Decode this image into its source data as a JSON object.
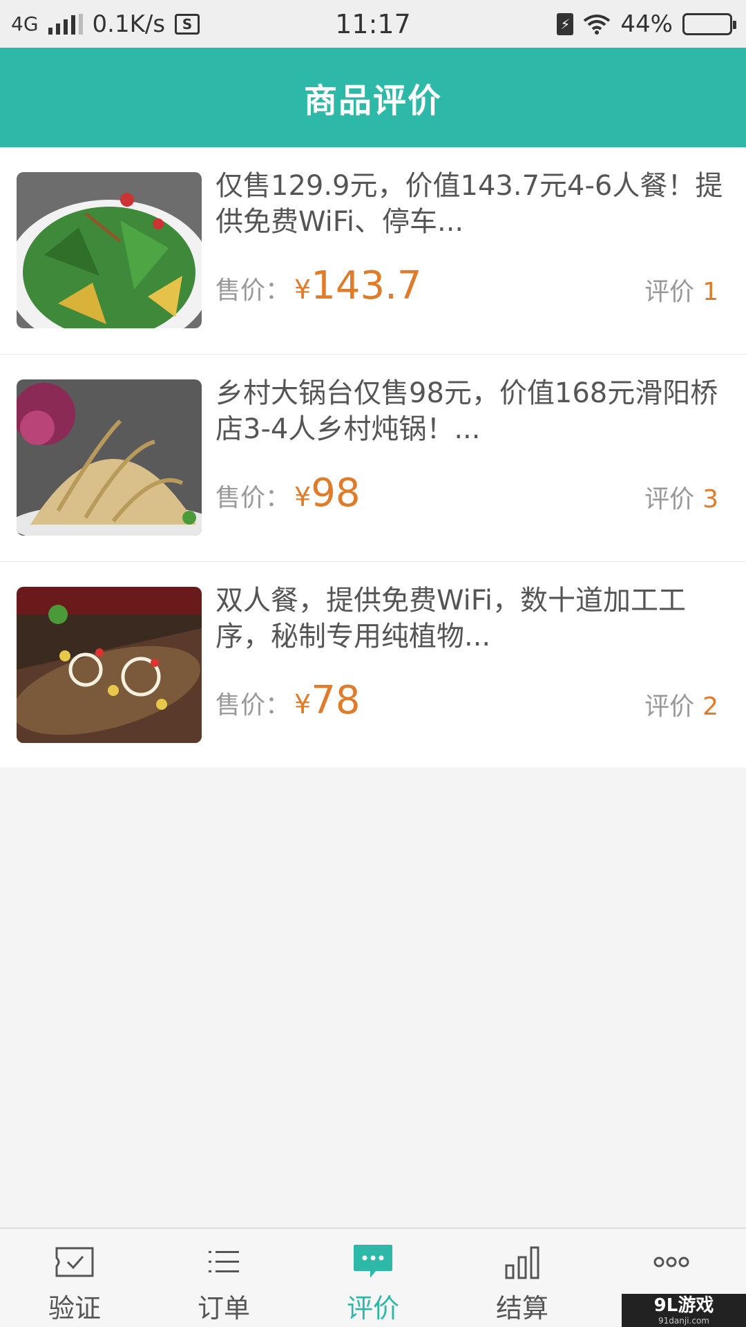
{
  "status_bar": {
    "network": "4G",
    "speed": "0.1K/s",
    "time": "11:17",
    "battery_percent": "44%",
    "battery_level": 0.44
  },
  "header": {
    "title": "商品评价"
  },
  "products": [
    {
      "title": "仅售129.9元，价值143.7元4-6人餐！提供免费WiFi、停车...",
      "price_label": "售价：",
      "currency": "¥",
      "price": "143.7",
      "review_label": "评价",
      "review_count": "1",
      "image": "salad-dish"
    },
    {
      "title": "乡村大锅台仅售98元，价值168元滑阳桥店3-4人乡村炖锅！...",
      "price_label": "售价：",
      "currency": "¥",
      "price": "98",
      "review_label": "评价",
      "review_count": "3",
      "image": "tofu-noodle-dish"
    },
    {
      "title": "双人餐，提供免费WiFi，数十道加工工序，秘制专用纯植物...",
      "price_label": "售价：",
      "currency": "¥",
      "price": "78",
      "review_label": "评价",
      "review_count": "2",
      "image": "grilled-fish-dish"
    }
  ],
  "bottom_nav": [
    {
      "label": "验证",
      "icon": "envelope-check-icon",
      "active": false
    },
    {
      "label": "订单",
      "icon": "list-icon",
      "active": false
    },
    {
      "label": "评价",
      "icon": "chat-bubble-icon",
      "active": true
    },
    {
      "label": "结算",
      "icon": "bar-chart-icon",
      "active": false
    },
    {
      "label": "更多",
      "icon": "more-dots-icon",
      "active": false
    }
  ],
  "colors": {
    "accent": "#2eb8a8",
    "price": "#e07b2a"
  },
  "watermark": {
    "brand": "9L游戏",
    "url": "91danji.com"
  }
}
